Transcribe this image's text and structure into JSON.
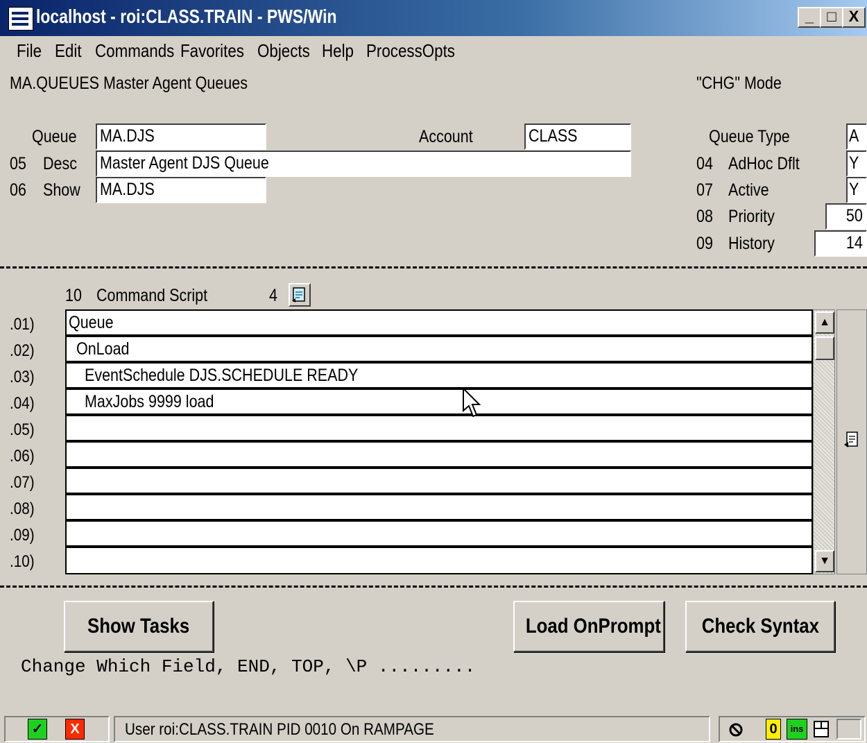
{
  "window": {
    "title": "localhost - roi:CLASS.TRAIN - PWS/Win",
    "minimize_glyph": "_",
    "maximize_glyph": "□",
    "close_glyph": "X"
  },
  "menu": [
    "File",
    "Edit",
    "Commands",
    "Favorites",
    "Objects",
    "Help",
    "ProcessOpts"
  ],
  "header": {
    "screen_title": "MA.QUEUES Master Agent Queues",
    "mode": "\"CHG\" Mode"
  },
  "form": {
    "queue_label": "Queue",
    "queue_value": "MA.DJS",
    "account_label": "Account",
    "account_value": "CLASS",
    "desc_num": "05",
    "desc_label": "Desc",
    "desc_value": "Master Agent DJS Queue",
    "show_num": "06",
    "show_label": "Show",
    "show_value": "MA.DJS",
    "queue_type_label": "Queue Type",
    "queue_type_value": "A",
    "adhoc_num": "04",
    "adhoc_label": "AdHoc Dflt",
    "adhoc_value": "Y",
    "active_num": "07",
    "active_label": "Active",
    "active_value": "Y",
    "priority_num": "08",
    "priority_label": "Priority",
    "priority_value": "50",
    "history_num": "09",
    "history_label": "History",
    "history_value": "14"
  },
  "script": {
    "num": "10",
    "label": "Command Script",
    "count": "4",
    "row_numbers": [
      ".01)",
      ".02)",
      ".03)",
      ".04)",
      ".05)",
      ".06)",
      ".07)",
      ".08)",
      ".09)",
      ".10)"
    ],
    "rows": [
      "Queue",
      " OnLoad",
      "  EventSchedule DJS.SCHEDULE READY",
      "  MaxJobs 9999 load",
      "",
      "",
      "",
      "",
      "",
      ""
    ]
  },
  "buttons": {
    "show_tasks": "Show Tasks",
    "load_onprompt": "Load OnPrompt",
    "check_syntax": "Check Syntax"
  },
  "prompt": "Change Which Field, END, TOP, \\P .........",
  "status": {
    "ok_glyph": "✓",
    "cancel_glyph": "X",
    "text": "User roi:CLASS.TRAIN PID 0010 On RAMPAGE",
    "indicator_zero": "0",
    "indicator_ins": "ins"
  },
  "colors": {
    "window_bg": "#d4d0c8",
    "title_bar": "#0a246a",
    "ok_green": "#1fd11f",
    "cancel_red": "#ff2a00"
  }
}
